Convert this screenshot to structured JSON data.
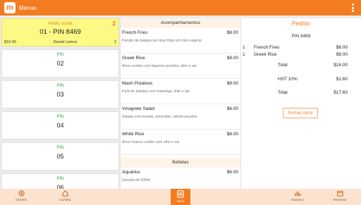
{
  "app": {
    "title": "Menuo",
    "logo_letter": "m"
  },
  "tables": [
    {
      "status": "Pediu conta",
      "title": "01 - PIN 8469",
      "count": "2",
      "amount": "$16.00",
      "waiter": "Daniel Lemos",
      "items": "2"
    },
    {
      "pin_label": "PIN",
      "number": "02"
    },
    {
      "pin_label": "PIN",
      "number": "03"
    },
    {
      "pin_label": "PIN",
      "number": "04"
    },
    {
      "pin_label": "PIN",
      "number": "05"
    },
    {
      "pin_label": "PIN",
      "number": "06"
    }
  ],
  "menu": {
    "section1": "Acompanhamentos",
    "section2": "Bebidas",
    "products": [
      {
        "name": "French Fries",
        "price": "$8.00",
        "desc": "Porção de batatas em tiras fritas em óleo vegetal"
      },
      {
        "name": "Greek Rice",
        "price": "$8.00",
        "desc": "Arroz cozido com legumes picados, alho e sal"
      },
      {
        "name": "Mash Potatoes",
        "price": "$8.00",
        "desc": "Purê de batatas com manteiga, leite e sal"
      },
      {
        "name": "Vinagrete Salad",
        "price": "$6.00",
        "desc": "Salada com tomate, pimentão, cebola picados"
      },
      {
        "name": "White Rice",
        "price": "$8.00",
        "desc": "Arroz branco cozido com alho e sal"
      }
    ],
    "drinks": [
      {
        "name": "Aquarius",
        "price": "$6.00",
        "desc": "Garrafa de 500ml"
      }
    ]
  },
  "order": {
    "title": "Pedido",
    "pin": "PIN 8469",
    "items": [
      {
        "qty": "1",
        "name": "French Fries",
        "price": "$8.00"
      },
      {
        "qty": "1",
        "name": "Greek Rice",
        "price": "$8.00"
      }
    ],
    "total_label": "Total",
    "total_value": "$16.00",
    "tax_label": "HST 10%",
    "tax_value": "$1.60",
    "grand_label": "Total",
    "grand_value": "$17.60",
    "close_button": "Fechar conta"
  },
  "nav": {
    "clients": "Clientes",
    "kitchen": "Cozinha",
    "start": "Início",
    "history": "Histórico",
    "reservations": "Reservas"
  },
  "colors": {
    "accent": "#f47c20",
    "active_card": "#fcf985",
    "pin_green": "#2fa84f",
    "count_red": "#d32020",
    "bottom_bar": "#fbe3cf"
  }
}
